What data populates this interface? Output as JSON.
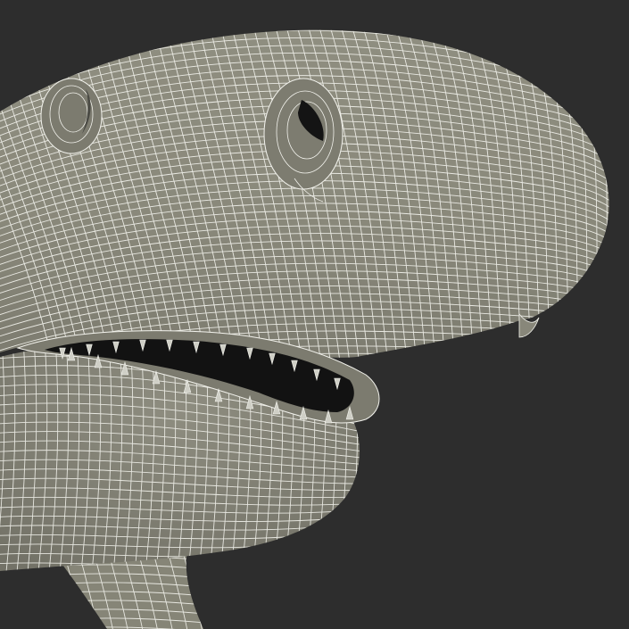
{
  "colors": {
    "background": "#2d2d2d",
    "mesh_fill": "#8b8a7b",
    "mesh_fill_light": "#9a998a",
    "mesh_fill_dark": "#6f6e62",
    "wire": "#f2f2ec",
    "mouth": "#121212",
    "teeth": "#cfcfc6"
  }
}
